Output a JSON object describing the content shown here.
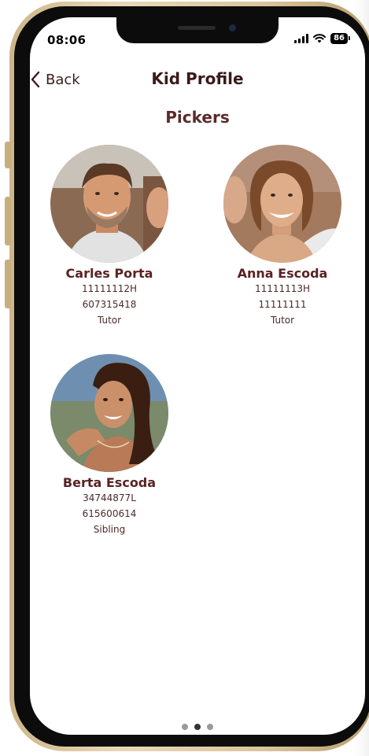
{
  "status_bar": {
    "time": "08:06",
    "battery": "86"
  },
  "header": {
    "back_label": "Back",
    "title": "Kid Profile"
  },
  "section_title": "Pickers",
  "pickers": [
    {
      "name": "Carles Porta",
      "id_number": "11111112H",
      "phone": "607315418",
      "relation": "Tutor"
    },
    {
      "name": "Anna Escoda",
      "id_number": "11111113H",
      "phone": "11111111",
      "relation": "Tutor"
    },
    {
      "name": "Berta Escoda",
      "id_number": "34744877L",
      "phone": "615600614",
      "relation": "Sibling"
    }
  ],
  "pager": {
    "count": 3,
    "active_index": 1
  },
  "colors": {
    "title": "#3a1a1a",
    "name": "#5a2222",
    "frame": "#d9c49c"
  }
}
